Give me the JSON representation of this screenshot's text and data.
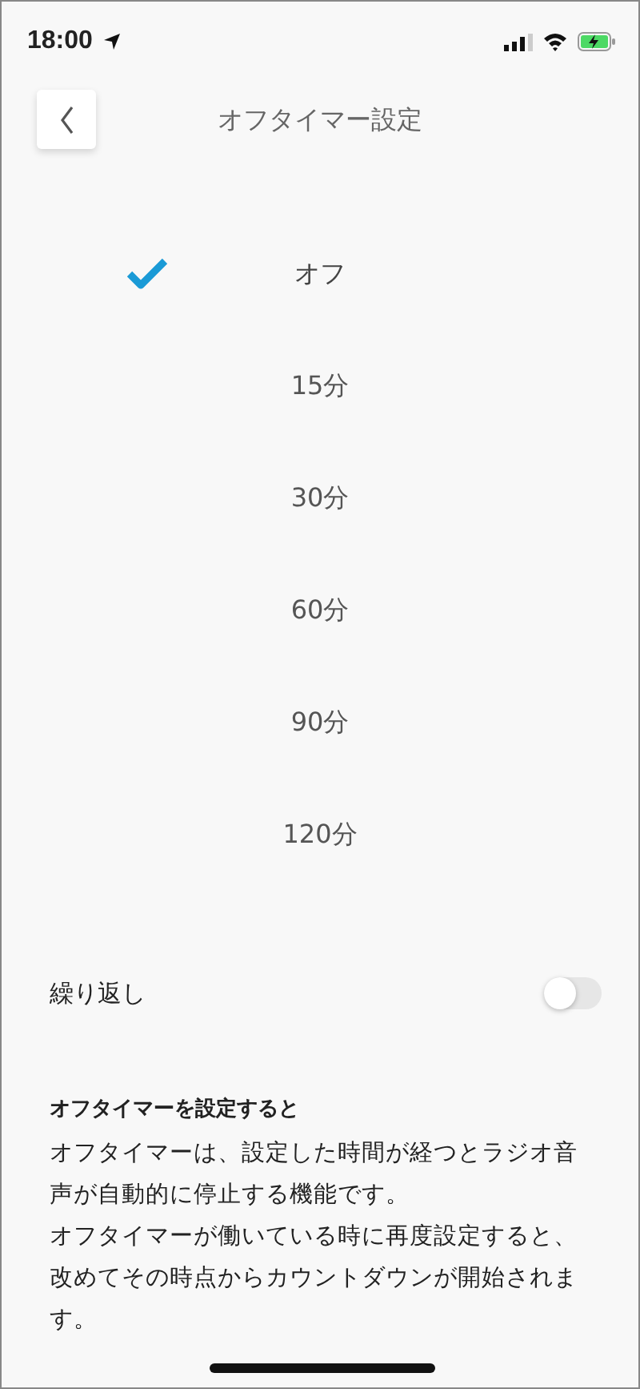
{
  "status_bar": {
    "time": "18:00"
  },
  "nav": {
    "title": "オフタイマー設定"
  },
  "options": [
    {
      "label": "オフ",
      "selected": true
    },
    {
      "label": "15分",
      "selected": false
    },
    {
      "label": "30分",
      "selected": false
    },
    {
      "label": "60分",
      "selected": false
    },
    {
      "label": "90分",
      "selected": false
    },
    {
      "label": "120分",
      "selected": false
    }
  ],
  "repeat": {
    "label": "繰り返し",
    "on": false
  },
  "description": {
    "heading": "オフタイマーを設定すると",
    "paragraphs": [
      "オフタイマーは、設定した時間が経つとラジオ音声が自動的に停止する機能です。",
      "オフタイマーが働いている時に再度設定すると、改めてその時点からカウントダウンが開始されます。"
    ]
  }
}
